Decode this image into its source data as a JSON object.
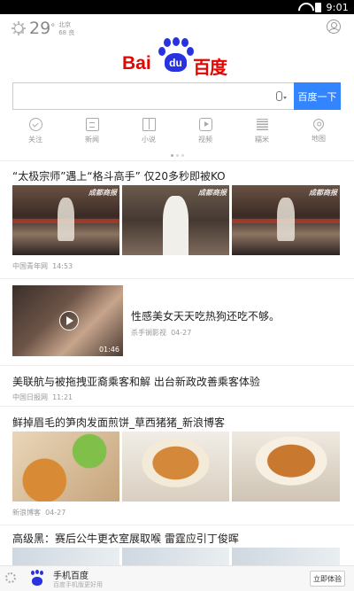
{
  "status_bar": {
    "time": "9:01"
  },
  "header": {
    "weather": {
      "temp": "29",
      "unit": "°",
      "city": "北京",
      "aqi": "68 良"
    },
    "logo": {
      "latin": "Bai",
      "paw_text": "du",
      "cn": "百度"
    }
  },
  "search": {
    "value": "",
    "placeholder": "",
    "button_label": "百度一下"
  },
  "quick_nav": [
    {
      "label": "关注",
      "icon": "follow-icon"
    },
    {
      "label": "新闻",
      "icon": "news-icon"
    },
    {
      "label": "小说",
      "icon": "novel-icon"
    },
    {
      "label": "视频",
      "icon": "video-icon"
    },
    {
      "label": "糯米",
      "icon": "nuomi-icon"
    },
    {
      "label": "地图",
      "icon": "map-icon"
    }
  ],
  "feed": [
    {
      "title": "“太极宗师”遇上“格斗高手” 仅20多秒即被KO",
      "source": "中国青年网",
      "time": "14:53",
      "watermark": "成都商报"
    },
    {
      "title": "性感美女天天吃热狗还吃不够。",
      "source": "杀手锏影视",
      "time": "04-27",
      "duration": "01:46"
    },
    {
      "title": "美联航与被拖拽亚裔乘客和解 出台新政改善乘客体验",
      "source": "中国日报网",
      "time": "11:21"
    },
    {
      "title": "鲜掉眉毛的笋肉发面煎饼_草西猪猪_新浪博客",
      "source": "新浪博客",
      "time": "04-27"
    },
    {
      "title": "高级黑：赛后公牛更衣室展取喉 雷霆应引丁俊晖"
    }
  ],
  "banner": {
    "title": "手机百度",
    "subtitle": "百度手机版更好用",
    "button_label": "立即体验"
  },
  "colors": {
    "brand_red": "#e10602",
    "brand_blue": "#2932e1",
    "button_blue": "#3385ff"
  }
}
